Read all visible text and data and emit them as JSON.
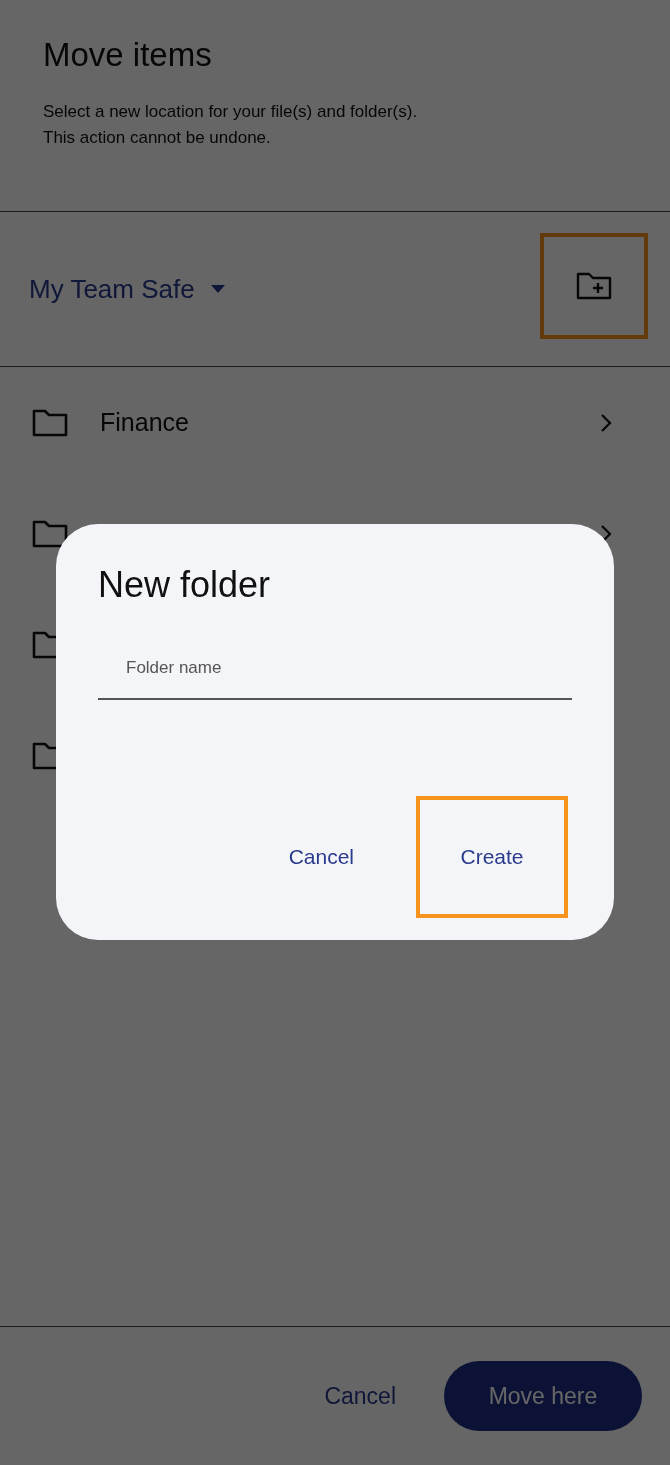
{
  "header": {
    "title": "Move items",
    "description_lines": [
      "Select a new location for your file(s) and folder(s).",
      "This action cannot be undone."
    ]
  },
  "location_bar": {
    "location": "My Team Safe",
    "new_folder_button": {
      "highlighted": true
    }
  },
  "folders": [
    {
      "kind": "folder",
      "name": "Finance",
      "has_children": true
    },
    {
      "kind": "folder",
      "has_children": true
    },
    {
      "kind": "folder"
    },
    {
      "kind": "folder"
    }
  ],
  "footer": {
    "cancel": "Cancel",
    "confirm": "Move here"
  },
  "dialog": {
    "title": "New folder",
    "field": {
      "placeholder": "Folder name"
    },
    "buttons": [
      {
        "label": "Cancel",
        "highlighted": false
      },
      {
        "label": "Create",
        "highlighted": true
      }
    ]
  }
}
